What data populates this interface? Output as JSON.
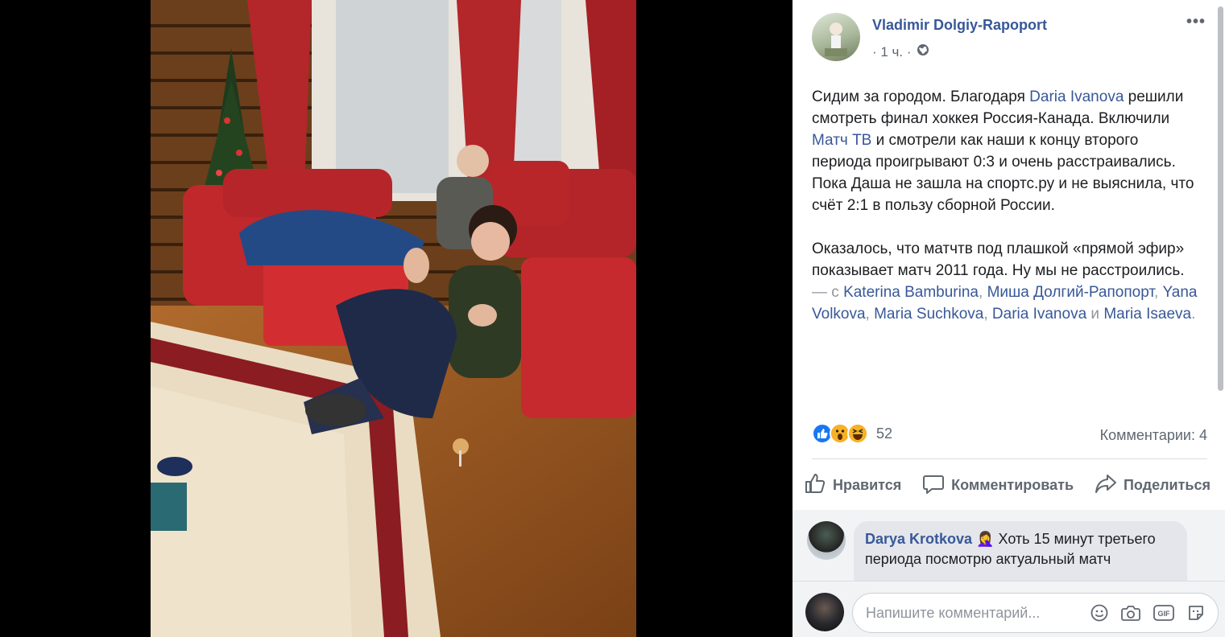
{
  "post": {
    "author": "Vladimir Dolgiy-Rapoport",
    "time": "· 1 ч. ·",
    "more": "•••",
    "text_p1": {
      "a": "Сидим за городом. Благодаря ",
      "link1": "Daria Ivanova",
      "b": " решили смотреть финал хоккея Россия-Канада. Включили ",
      "link2": "Матч ТВ",
      "c": " и смотрели как наши к концу второго периода проигрывают 0:3 и очень расстраивались. Пока Даша не зашла на спортс.ру и не выяснила, что счёт 2:1 в пользу сборной России."
    },
    "text_p2": {
      "a": "Оказалось, что матчтв под плашкой «прямой эфир» показывает матч 2011 года. Ну мы не расстроились.",
      "with": " — с ",
      "t1": "Katerina Bamburina",
      "s1": ", ",
      "t2": "Миша Долгий-Рапопорт",
      "s2": ", ",
      "t3": "Yana Volkova",
      "s3": ", ",
      "t4": "Maria Suchkova",
      "s4": ", ",
      "t5": "Daria Ivanova",
      "and": " и ",
      "t6": "Maria Isaeva",
      "end": "."
    }
  },
  "reactions": {
    "count": "52",
    "comments": "Комментарии: 4",
    "icons": [
      "like-icon",
      "wow-icon",
      "haha-icon"
    ]
  },
  "actions": {
    "like": "Нравится",
    "comment": "Комментировать",
    "share": "Поделиться"
  },
  "comment": {
    "author": "Darya Krotkova",
    "emoji": "🤦‍♀️",
    "text": " Хоть 15 минут третьего периода посмотрю актуальный матч"
  },
  "composer": {
    "placeholder": "Напишите комментарий...",
    "icons": [
      "emoji-icon",
      "camera-icon",
      "gif-icon",
      "sticker-icon"
    ],
    "gif": "GIF"
  },
  "colors": {
    "link": "#385898",
    "like": "#1877f2",
    "reaction_yellow": "#f7b125"
  }
}
